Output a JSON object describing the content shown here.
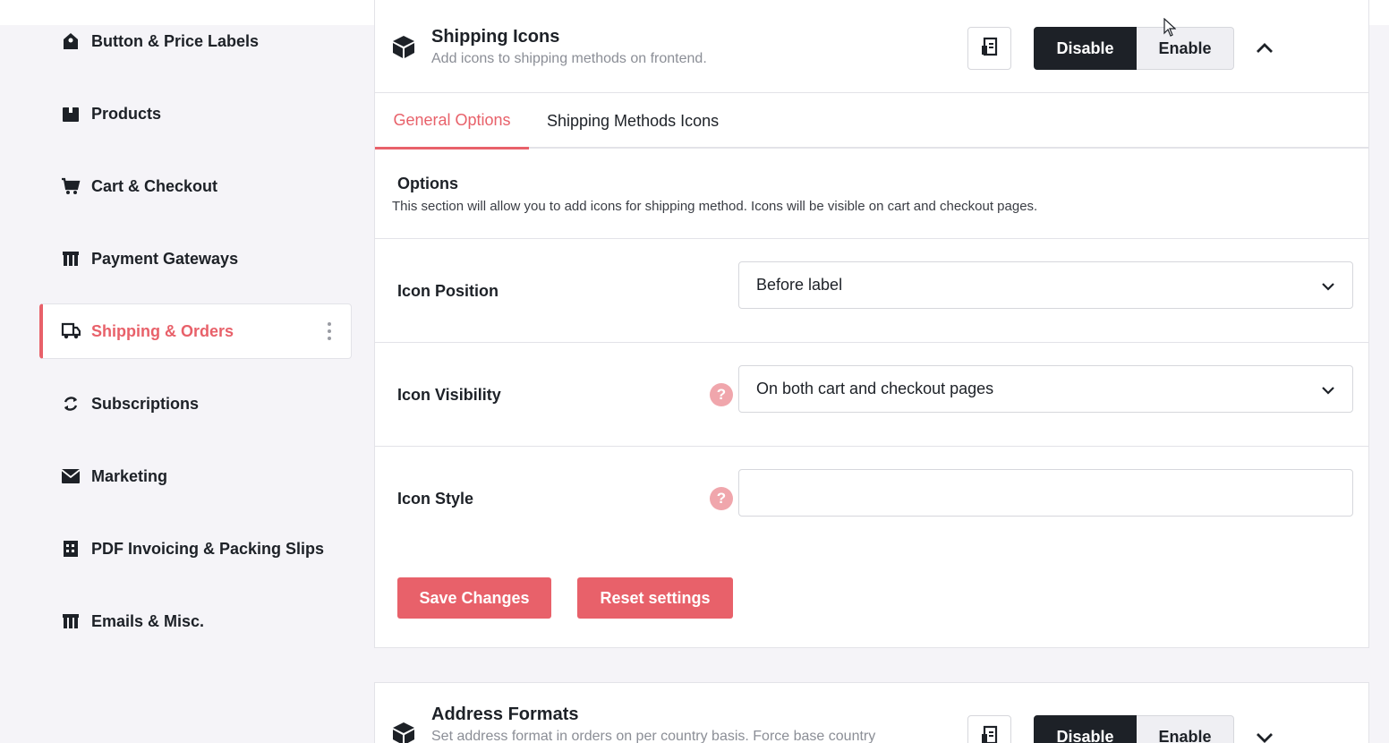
{
  "sidebar": {
    "items": [
      {
        "label": "Button & Price Labels",
        "icon": "label-icon"
      },
      {
        "label": "Products",
        "icon": "box-icon"
      },
      {
        "label": "Cart & Checkout",
        "icon": "cart-icon"
      },
      {
        "label": "Payment Gateways",
        "icon": "gateway-icon"
      },
      {
        "label": "Shipping & Orders",
        "icon": "truck-icon",
        "active": true
      },
      {
        "label": "Subscriptions",
        "icon": "refresh-icon"
      },
      {
        "label": "Marketing",
        "icon": "envelope-icon"
      },
      {
        "label": "PDF Invoicing & Packing Slips",
        "icon": "invoice-icon"
      },
      {
        "label": "Emails & Misc.",
        "icon": "gateway-icon"
      }
    ]
  },
  "module": {
    "title": "Shipping Icons",
    "description": "Add icons to shipping methods on frontend.",
    "disable_label": "Disable",
    "enable_label": "Enable"
  },
  "tabs": [
    {
      "label": "General Options",
      "active": true
    },
    {
      "label": "Shipping Methods Icons"
    }
  ],
  "options": {
    "title": "Options",
    "description": "This section will allow you to add icons for shipping method. Icons will be visible on cart and checkout pages."
  },
  "fields": {
    "icon_position": {
      "label": "Icon Position",
      "value": "Before label"
    },
    "icon_visibility": {
      "label": "Icon Visibility",
      "value": "On both cart and checkout pages"
    },
    "icon_style": {
      "label": "Icon Style",
      "value": ""
    }
  },
  "actions": {
    "save_label": "Save Changes",
    "reset_label": "Reset settings"
  },
  "module2": {
    "title": "Address Formats",
    "description": "Set address format in orders on per country basis. Force base country",
    "disable_label": "Disable",
    "enable_label": "Enable"
  },
  "colors": {
    "accent": "#e8616a",
    "dark": "#1d2127",
    "background": "#f5f4f8"
  }
}
